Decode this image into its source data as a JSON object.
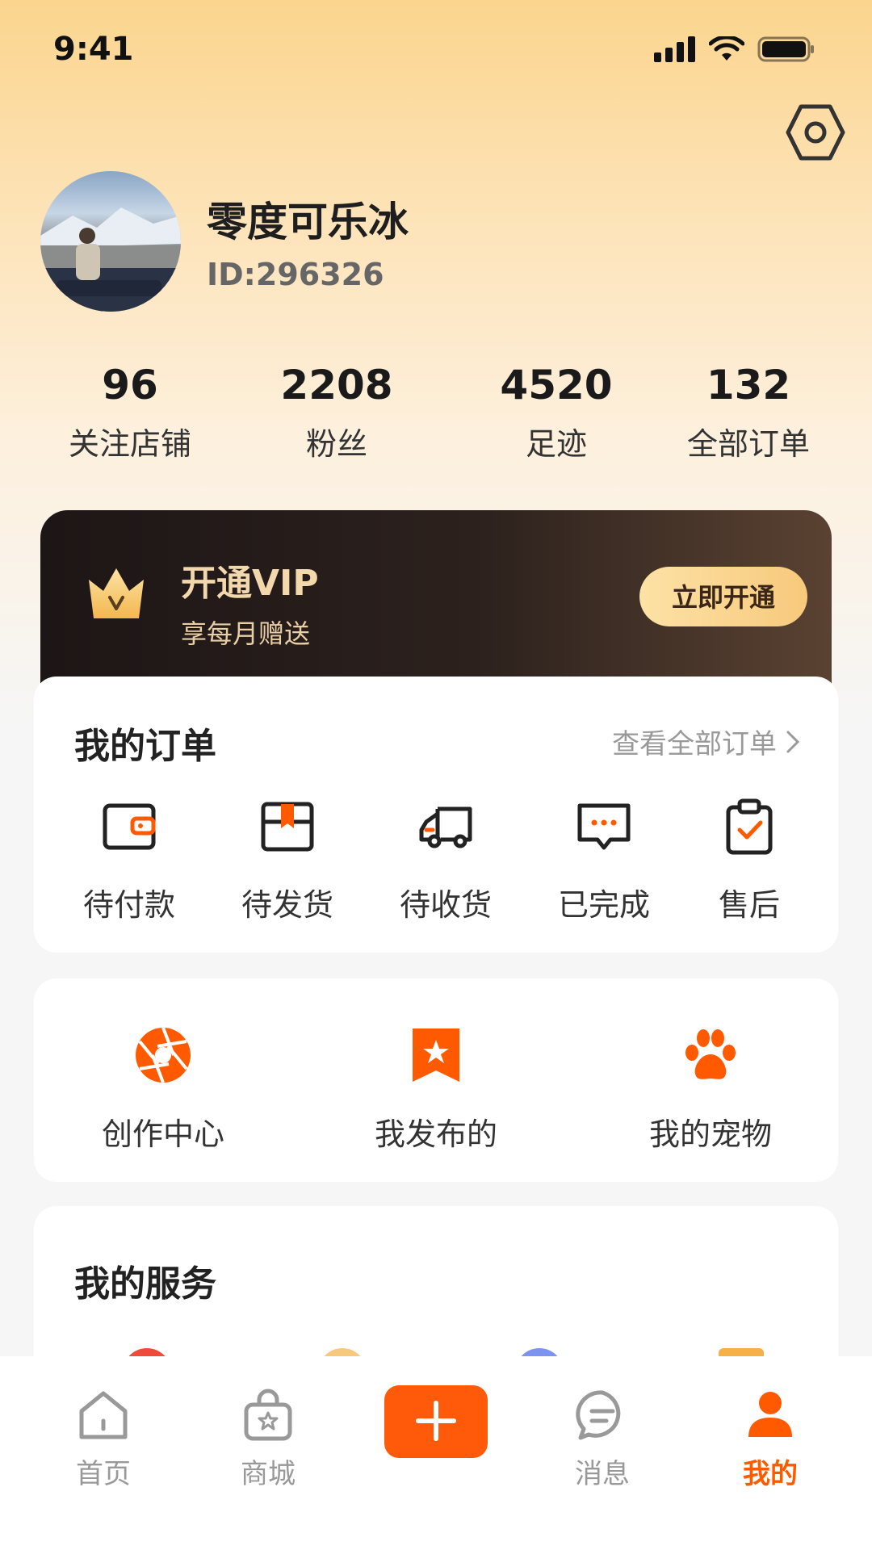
{
  "status_bar": {
    "time": "9:41"
  },
  "profile": {
    "username": "零度可乐冰",
    "id_text": "ID:296326"
  },
  "stats": [
    {
      "value": "96",
      "label": "关注店铺"
    },
    {
      "value": "2208",
      "label": "粉丝"
    },
    {
      "value": "4520",
      "label": "足迹"
    },
    {
      "value": "132",
      "label": "全部订单"
    }
  ],
  "vip": {
    "title": "开通VIP",
    "subtitle": "享每月赠送",
    "button_label": "立即开通"
  },
  "orders": {
    "title": "我的订单",
    "see_all_label": "查看全部订单",
    "items": [
      {
        "label": "待付款",
        "icon": "wallet-icon"
      },
      {
        "label": "待发货",
        "icon": "box-icon"
      },
      {
        "label": "待收货",
        "icon": "truck-icon"
      },
      {
        "label": "已完成",
        "icon": "chat-bubble-icon"
      },
      {
        "label": "售后",
        "icon": "clipboard-check-icon"
      }
    ]
  },
  "tools": [
    {
      "label": "创作中心",
      "icon": "aperture-icon"
    },
    {
      "label": "我发布的",
      "icon": "bookmark-star-icon"
    },
    {
      "label": "我的宠物",
      "icon": "paw-icon"
    }
  ],
  "services": {
    "title": "我的服务"
  },
  "tabbar": [
    {
      "label": "首页",
      "icon": "home-icon"
    },
    {
      "label": "商城",
      "icon": "shopping-bag-icon"
    },
    {
      "label": "",
      "icon": "plus-icon"
    },
    {
      "label": "消息",
      "icon": "message-icon"
    },
    {
      "label": "我的",
      "icon": "user-icon",
      "active": true
    }
  ],
  "colors": {
    "accent": "#ff5a00",
    "vip_gold": "#f7c97c"
  }
}
